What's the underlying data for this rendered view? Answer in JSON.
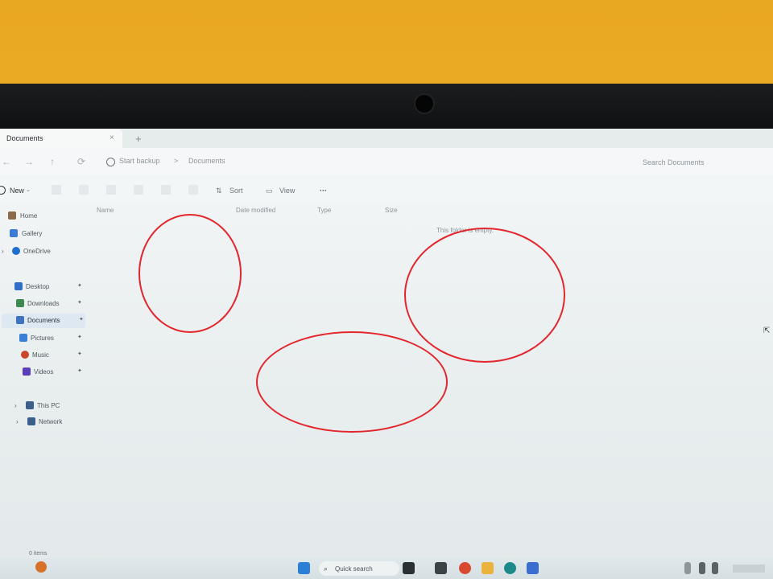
{
  "window": {
    "tab_title": "Documents",
    "tab_close": "×",
    "tab_new": "+"
  },
  "address": {
    "back_icon": "←",
    "forward_icon": "→",
    "up_icon": "↑",
    "refresh_icon": "⟳",
    "crumb_backup": "Start backup",
    "crumb_sep": ">",
    "crumb_documents": "Documents",
    "search_placeholder": "Search Documents"
  },
  "commandbar": {
    "new_label": "New",
    "sort_label": "Sort",
    "view_label": "View",
    "more_label": "···"
  },
  "sidebar": {
    "items": [
      {
        "label": "Home"
      },
      {
        "label": "Gallery"
      },
      {
        "label": "OneDrive"
      },
      {
        "label": "Desktop"
      },
      {
        "label": "Downloads"
      },
      {
        "label": "Documents"
      },
      {
        "label": "Pictures"
      },
      {
        "label": "Music"
      },
      {
        "label": "Videos"
      },
      {
        "label": "This PC"
      },
      {
        "label": "Network"
      }
    ],
    "pin_glyph": "✦",
    "chevron_glyph": "›"
  },
  "filelist": {
    "col_name": "Name",
    "col_date": "Date modified",
    "col_type": "Type",
    "col_size": "Size",
    "empty_message": "This folder is empty."
  },
  "status": {
    "items_count": "0 items"
  },
  "taskbar": {
    "search_label": "Quick search"
  },
  "colors": {
    "annotation_circle": "#e3262d",
    "background_wall": "#f0b12a",
    "bezel": "#111213"
  }
}
